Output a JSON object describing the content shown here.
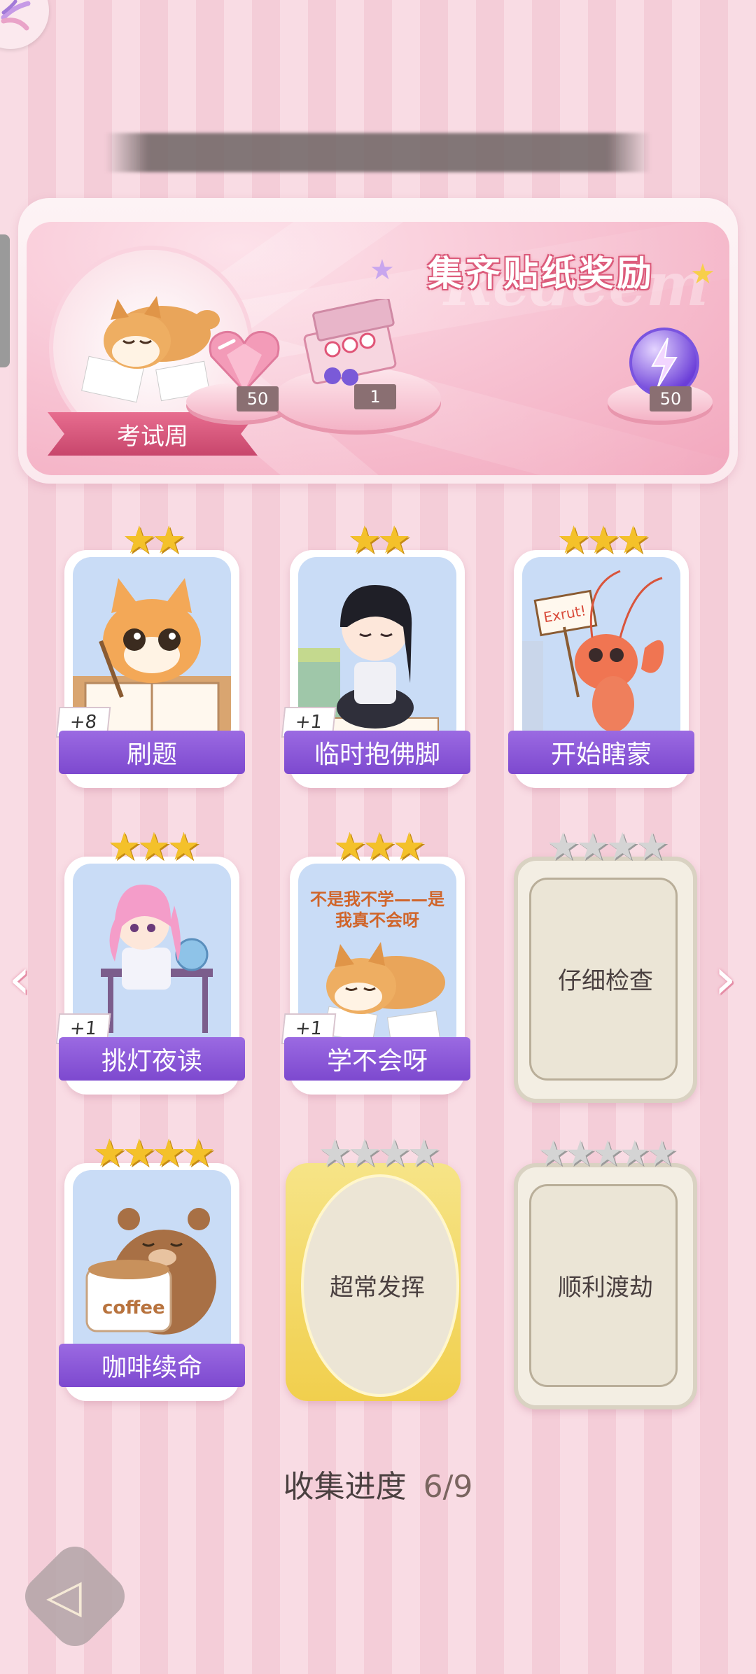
{
  "banner": {
    "title": "集齐贴纸奖励",
    "watermark": "Redeem",
    "theme_label": "考试周",
    "rewards": [
      {
        "icon": "pink-heart-gem-icon",
        "qty": "50"
      },
      {
        "icon": "gift-box-icon",
        "qty": "1"
      },
      {
        "icon": "purple-lightning-orb-icon",
        "qty": "50"
      }
    ]
  },
  "stickers": [
    {
      "name": "刷题",
      "stars": 2,
      "badge": "+8",
      "collected": true,
      "art": "cat-studying-icon"
    },
    {
      "name": "临时抱佛脚",
      "stars": 2,
      "badge": "+1",
      "collected": true,
      "art": "girl-praying-icon"
    },
    {
      "name": "开始瞎蒙",
      "stars": 3,
      "badge": "",
      "collected": true,
      "art": "shrimp-sign-icon",
      "sign_text": "Exrut!"
    },
    {
      "name": "挑灯夜读",
      "stars": 3,
      "badge": "+1",
      "collected": true,
      "art": "girl-desk-icon"
    },
    {
      "name": "学不会呀",
      "stars": 3,
      "badge": "+1",
      "collected": true,
      "art": "shiba-lying-icon",
      "art_text": "不是我不学——是我真不会呀"
    },
    {
      "name": "仔细检查",
      "stars": 4,
      "badge": "",
      "collected": false,
      "frame": "plain"
    },
    {
      "name": "咖啡续命",
      "stars": 4,
      "badge": "",
      "collected": true,
      "art": "bear-coffee-icon",
      "art_text": "coffee"
    },
    {
      "name": "超常发挥",
      "stars": 4,
      "badge": "",
      "collected": false,
      "frame": "gold"
    },
    {
      "name": "顺利渡劫",
      "stars": 5,
      "badge": "",
      "collected": false,
      "frame": "plain"
    }
  ],
  "progress": {
    "label": "收集进度",
    "value": "6/9"
  },
  "colors": {
    "label_purple": "#8a57d8",
    "banner_pink": "#f2a7bd",
    "star_gold": "#f4c12a"
  }
}
